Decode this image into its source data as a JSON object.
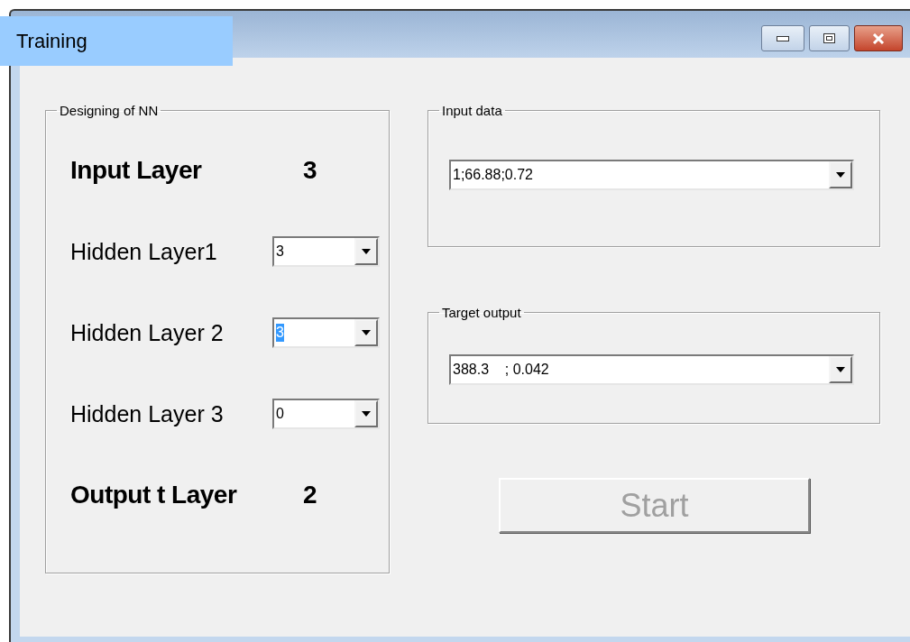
{
  "window": {
    "title": "Training"
  },
  "design_group": {
    "title": "Designing of NN",
    "input_layer": {
      "label": "Input Layer",
      "value": "3"
    },
    "hidden_layers": [
      {
        "label": "Hidden Layer1",
        "value": "3",
        "selected": false
      },
      {
        "label": "Hidden Layer 2",
        "value": "3",
        "selected": true
      },
      {
        "label": "Hidden Layer 3",
        "value": "0",
        "selected": false
      }
    ],
    "output_layer": {
      "label": "Output t Layer",
      "value": "2"
    }
  },
  "input_data": {
    "title": "Input data",
    "value": "1;66.88;0.72"
  },
  "target_output": {
    "title": "Target output",
    "value": "388.3    ; 0.042"
  },
  "start_button": {
    "label": "Start",
    "disabled": true
  }
}
